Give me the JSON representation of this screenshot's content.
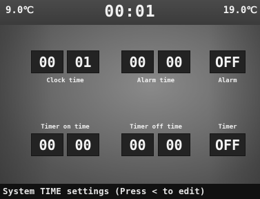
{
  "header": {
    "left_temp": "9.0℃",
    "time": "00:01",
    "right_temp": "19.0℃"
  },
  "clock": {
    "hours": "00",
    "minutes": "01",
    "label": "Clock time"
  },
  "alarm_time": {
    "hours": "00",
    "minutes": "00",
    "label": "Alarm time"
  },
  "alarm": {
    "value": "OFF",
    "label": "Alarm"
  },
  "timer_on": {
    "hours": "00",
    "minutes": "00",
    "label": "Timer on time"
  },
  "timer_off": {
    "hours": "00",
    "minutes": "00",
    "label": "Timer off time"
  },
  "timer": {
    "value": "OFF",
    "label": "Timer"
  },
  "status": {
    "text": "System TIME settings (Press < to edit)"
  },
  "colors": {
    "box_bg": "#232323",
    "panel_bg": "#6f6f6f",
    "header_bg": "#434343",
    "text": "#f4f4f4"
  }
}
